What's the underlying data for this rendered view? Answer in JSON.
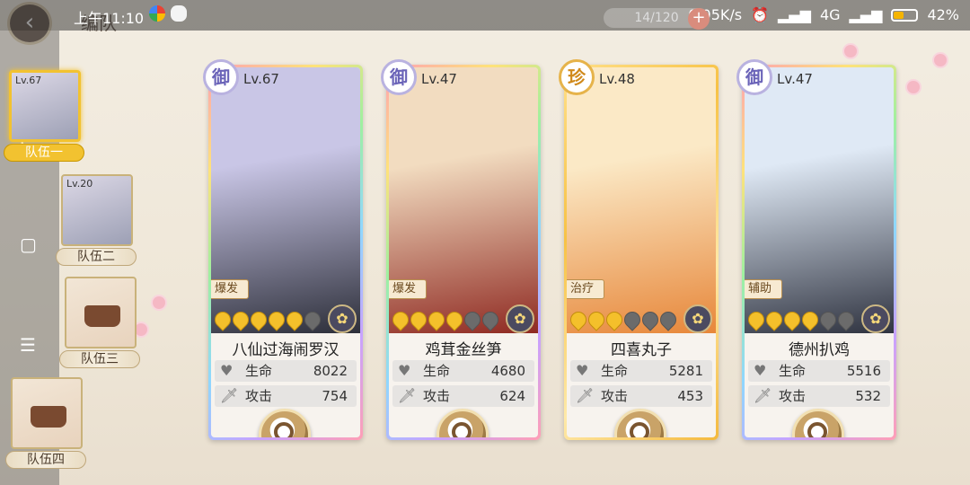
{
  "status_bar": {
    "time": "上午11:10",
    "network_speed": "0.05K/s",
    "network_type": "4G",
    "battery": "42%",
    "battery_level": 0.42
  },
  "header": {
    "title": "编队",
    "energy": "14/120"
  },
  "teams": [
    {
      "label": "队伍一",
      "level": "Lv.67",
      "active": true,
      "empty": false
    },
    {
      "label": "队伍二",
      "level": "Lv.20",
      "active": false,
      "empty": false
    },
    {
      "label": "队伍三",
      "level": "",
      "active": false,
      "empty": true
    },
    {
      "label": "队伍四",
      "level": "",
      "active": false,
      "empty": true
    }
  ],
  "stat_labels": {
    "hp": "生命",
    "atk": "攻击"
  },
  "cards": [
    {
      "rank": "御",
      "level": "Lv.67",
      "role": "爆发",
      "name": "八仙过海闹罗汉",
      "hp": "8022",
      "atk": "754",
      "stars_filled": 5,
      "stars_total": 6,
      "art_colors": [
        "#c9c6e6",
        "#2d2f3a"
      ],
      "frame": "rainbow"
    },
    {
      "rank": "御",
      "level": "Lv.47",
      "role": "爆发",
      "name": "鸡茸金丝笋",
      "hp": "4680",
      "atk": "624",
      "stars_filled": 4,
      "stars_total": 6,
      "art_colors": [
        "#f2dcc0",
        "#8f2a22"
      ],
      "frame": "rainbow"
    },
    {
      "rank": "珍",
      "level": "Lv.48",
      "role": "治疗",
      "name": "四喜丸子",
      "hp": "5281",
      "atk": "453",
      "stars_filled": 3,
      "stars_total": 6,
      "art_colors": [
        "#fbe9c6",
        "#e7873a"
      ],
      "frame": "gold"
    },
    {
      "rank": "御",
      "level": "Lv.47",
      "role": "辅助",
      "name": "德州扒鸡",
      "hp": "5516",
      "atk": "532",
      "stars_filled": 4,
      "stars_total": 6,
      "art_colors": [
        "#dfe9f5",
        "#2f3340"
      ],
      "frame": "rainbow"
    }
  ]
}
